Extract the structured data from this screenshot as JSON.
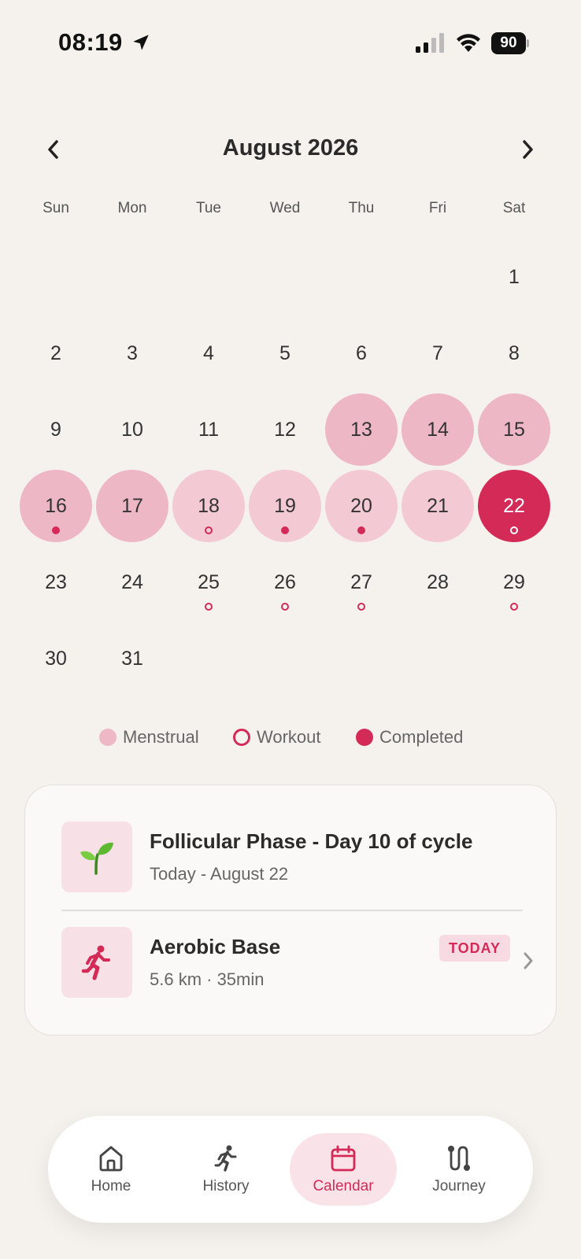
{
  "status_bar": {
    "time": "08:19",
    "battery": "90"
  },
  "calendar": {
    "month_title": "August 2026",
    "weekdays": [
      "Sun",
      "Mon",
      "Tue",
      "Wed",
      "Thu",
      "Fri",
      "Sat"
    ],
    "days": [
      {
        "day": "1",
        "phase": "none",
        "marker": "none"
      },
      {
        "day": "2",
        "phase": "none",
        "marker": "none"
      },
      {
        "day": "3",
        "phase": "none",
        "marker": "none"
      },
      {
        "day": "4",
        "phase": "none",
        "marker": "none"
      },
      {
        "day": "5",
        "phase": "none",
        "marker": "none"
      },
      {
        "day": "6",
        "phase": "none",
        "marker": "none"
      },
      {
        "day": "7",
        "phase": "none",
        "marker": "none"
      },
      {
        "day": "8",
        "phase": "none",
        "marker": "none"
      },
      {
        "day": "9",
        "phase": "none",
        "marker": "none"
      },
      {
        "day": "10",
        "phase": "none",
        "marker": "none"
      },
      {
        "day": "11",
        "phase": "none",
        "marker": "none"
      },
      {
        "day": "12",
        "phase": "none",
        "marker": "none"
      },
      {
        "day": "13",
        "phase": "menstrual",
        "marker": "none"
      },
      {
        "day": "14",
        "phase": "menstrual",
        "marker": "none"
      },
      {
        "day": "15",
        "phase": "menstrual",
        "marker": "none"
      },
      {
        "day": "16",
        "phase": "menstrual",
        "marker": "completed"
      },
      {
        "day": "17",
        "phase": "menstrual",
        "marker": "none"
      },
      {
        "day": "18",
        "phase": "menstrual-light",
        "marker": "workout"
      },
      {
        "day": "19",
        "phase": "menstrual-light",
        "marker": "completed"
      },
      {
        "day": "20",
        "phase": "menstrual-light",
        "marker": "completed"
      },
      {
        "day": "21",
        "phase": "menstrual-light",
        "marker": "none"
      },
      {
        "day": "22",
        "phase": "selected",
        "marker": "workout"
      },
      {
        "day": "23",
        "phase": "none",
        "marker": "none"
      },
      {
        "day": "24",
        "phase": "none",
        "marker": "none"
      },
      {
        "day": "25",
        "phase": "none",
        "marker": "workout"
      },
      {
        "day": "26",
        "phase": "none",
        "marker": "workout"
      },
      {
        "day": "27",
        "phase": "none",
        "marker": "workout"
      },
      {
        "day": "28",
        "phase": "none",
        "marker": "none"
      },
      {
        "day": "29",
        "phase": "none",
        "marker": "workout"
      },
      {
        "day": "30",
        "phase": "none",
        "marker": "none"
      },
      {
        "day": "31",
        "phase": "none",
        "marker": "none"
      }
    ]
  },
  "legend": {
    "menstrual": "Menstrual",
    "workout": "Workout",
    "completed": "Completed"
  },
  "info_card": {
    "phase_title": "Follicular Phase - Day 10 of cycle",
    "phase_sub": "Today - August 22",
    "workout_title": "Aerobic Base",
    "workout_sub": "5.6 km · 35min",
    "badge": "TODAY"
  },
  "nav": {
    "items": [
      {
        "label": "Home",
        "icon": "home-icon"
      },
      {
        "label": "History",
        "icon": "runner-icon"
      },
      {
        "label": "Calendar",
        "icon": "calendar-icon"
      },
      {
        "label": "Journey",
        "icon": "route-icon"
      }
    ],
    "active": "Calendar"
  },
  "colors": {
    "accent": "#d42a57",
    "menstrual": "#edb7c5",
    "menstrual_light": "#f3c9d4",
    "background": "#f5f2ee"
  }
}
